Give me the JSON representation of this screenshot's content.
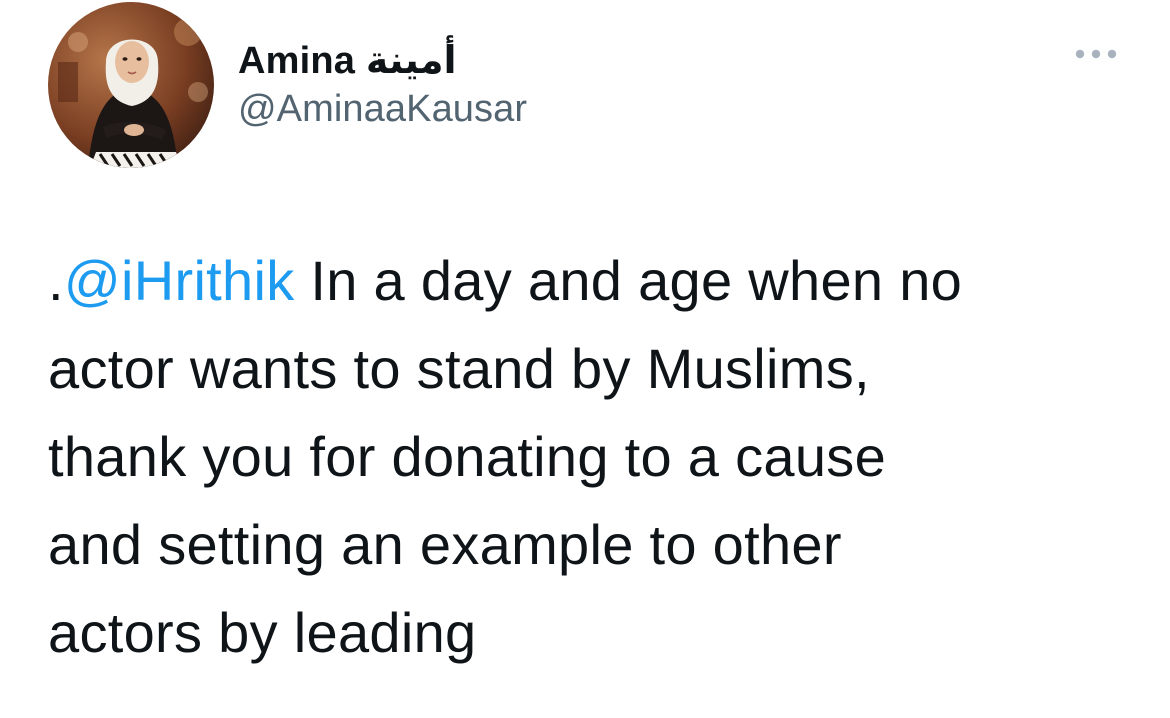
{
  "tweet": {
    "author": {
      "display_name": "Amina أمينة",
      "handle": "@AminaaKausar",
      "avatar_icon": "profile-photo"
    },
    "more_icon": "more-horizontal-icon",
    "text": {
      "prefix": ".",
      "mention": "@iHrithik",
      "line1_rest": " In a day and age when no",
      "line2": "actor wants to stand by Muslims,",
      "line3": "thank you for donating to a cause",
      "line4": "and setting an example to other",
      "line5": "actors by leading"
    }
  },
  "colors": {
    "text": "#0f1419",
    "secondary": "#536471",
    "link": "#1d9bf0",
    "icon": "#a8b3bd"
  }
}
